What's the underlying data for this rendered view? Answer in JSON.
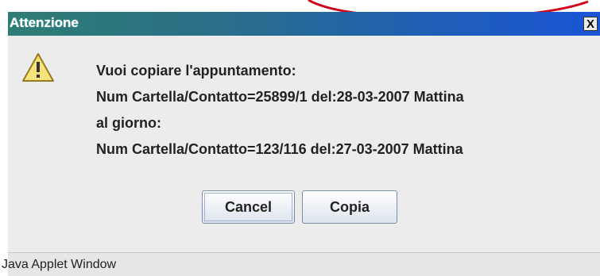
{
  "dialog": {
    "title": "Attenzione",
    "close_label": "X",
    "warning_icon": "warning-icon",
    "message_lines": [
      "Vuoi copiare l'appuntamento:",
      "Num Cartella/Contatto=25899/1 del:28-03-2007 Mattina",
      "al giorno:",
      "Num Cartella/Contatto=123/116 del:27-03-2007 Mattina"
    ],
    "buttons": {
      "cancel": "Cancel",
      "copia": "Copia"
    },
    "status_text": "Java Applet Window"
  },
  "colors": {
    "titlebar_start": "#2e7d74",
    "titlebar_end": "#1a55d6",
    "annotation": "#d0021b"
  }
}
